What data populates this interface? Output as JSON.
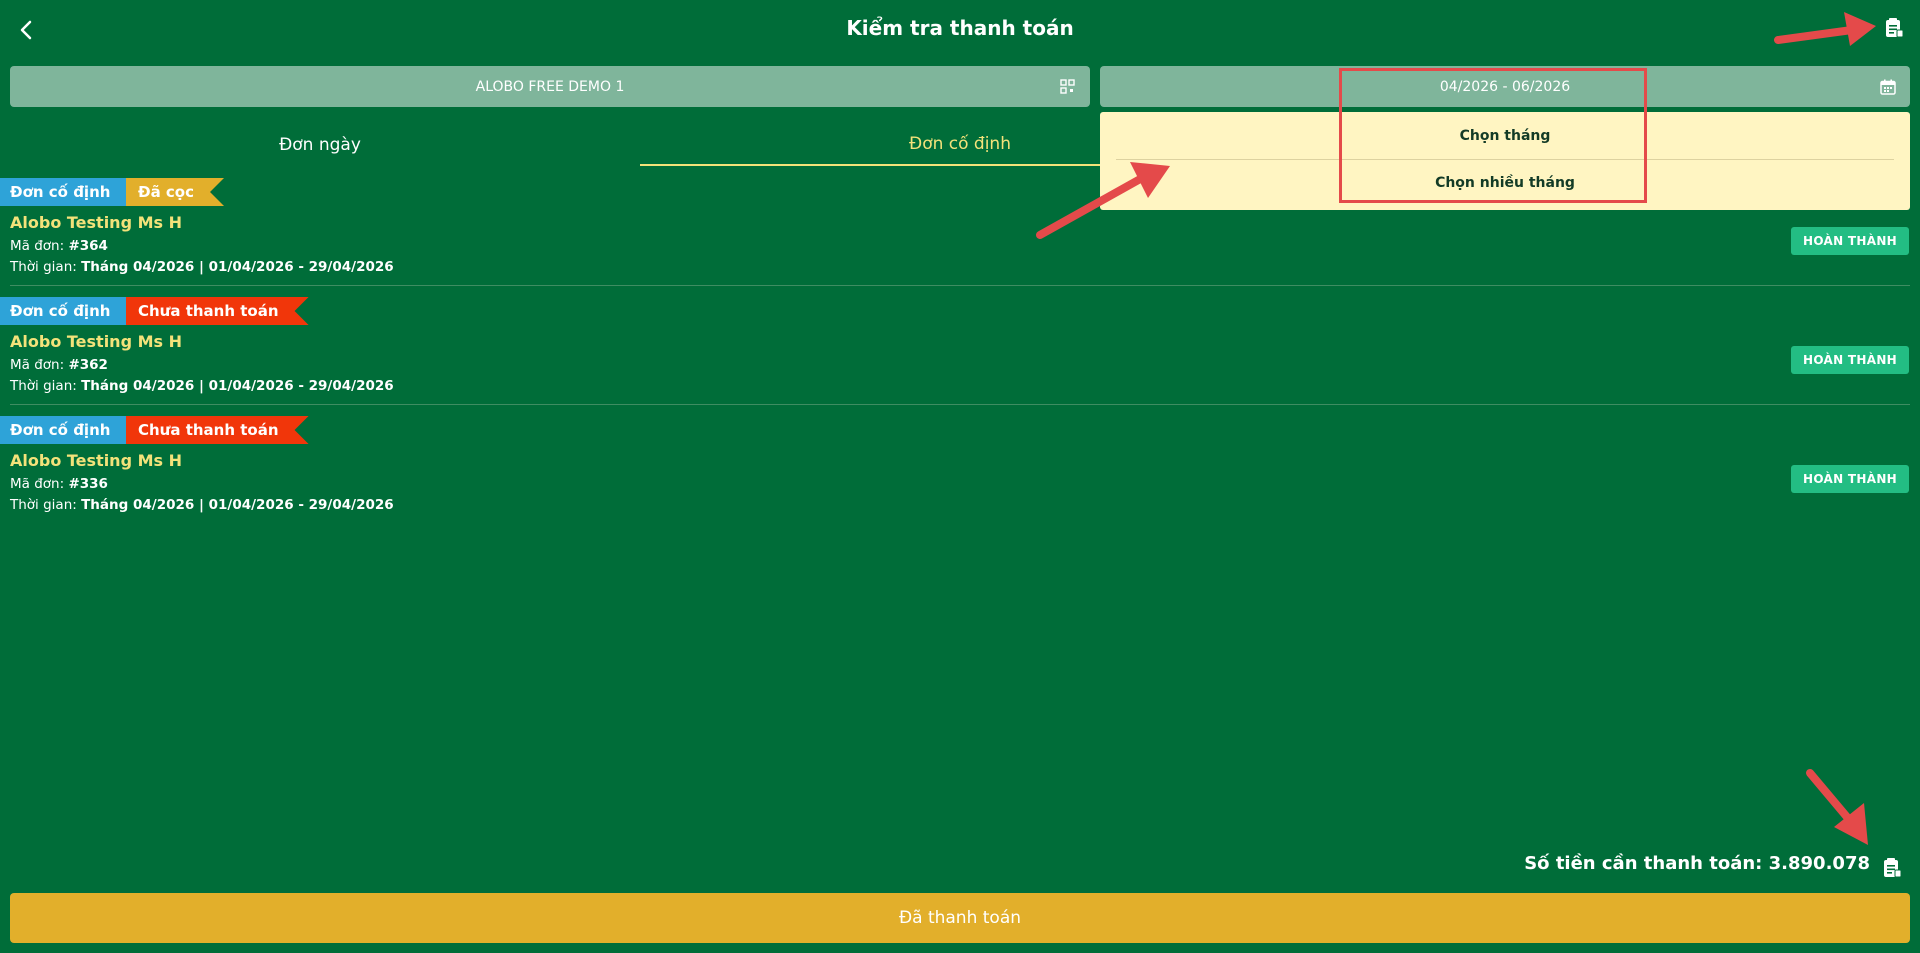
{
  "header": {
    "title": "Kiểm tra thanh toán",
    "back_icon": "chevron-left-icon",
    "report_icon": "clipboard-icon"
  },
  "filters": {
    "venue": "ALOBO FREE DEMO 1",
    "venue_icon": "qr-code-icon",
    "date_range": "04/2026 - 06/2026",
    "date_icon": "calendar-icon"
  },
  "tabs": [
    {
      "label": "Đơn ngày",
      "active": false
    },
    {
      "label": "Đơn cố định",
      "active": true
    }
  ],
  "dropdown": {
    "items": [
      "Chọn tháng",
      "Chọn nhiều tháng"
    ]
  },
  "orders": [
    {
      "type": "Đơn cố định",
      "status": "Đã cọc",
      "customer": "Alobo Testing Ms H",
      "id_label": "Mã đơn: ",
      "id": "#364",
      "time_label": "Thời gian: ",
      "time": "Tháng 04/2026 | 01/04/2026 - 29/04/2026",
      "action": "HOÀN THÀNH"
    },
    {
      "type": "Đơn cố định",
      "status": "Chưa thanh toán",
      "customer": "Alobo Testing Ms H",
      "id_label": "Mã đơn: ",
      "id": "#362",
      "time_label": "Thời gian: ",
      "time": "Tháng 04/2026 | 01/04/2026 - 29/04/2026",
      "action": "HOÀN THÀNH"
    },
    {
      "type": "Đơn cố định",
      "status": "Chưa thanh toán",
      "customer": "Alobo Testing Ms H",
      "id_label": "Mã đơn: ",
      "id": "#336",
      "time_label": "Thời gian: ",
      "time": "Tháng 04/2026 | 01/04/2026 - 29/04/2026",
      "action": "HOÀN THÀNH"
    }
  ],
  "footer": {
    "total_label": "Số tiền cần thanh toán: ",
    "total_value": "3.890.078",
    "paid_button": "Đã thanh toán"
  },
  "colors": {
    "background": "#006d39",
    "accent_yellow": "#f3e27a",
    "gold": "#e2af2b",
    "tag_blue": "#2ea3d8",
    "tag_red": "#f1360a",
    "done_green": "#23bd83",
    "annotation_red": "#e44a4a"
  }
}
